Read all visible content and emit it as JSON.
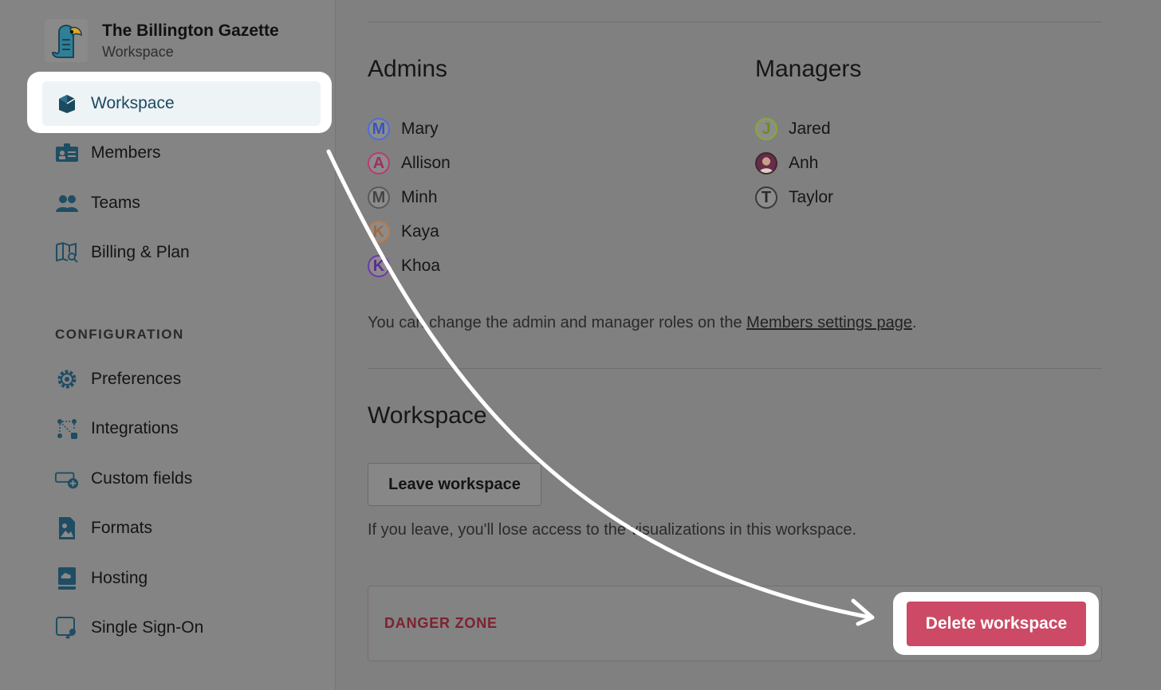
{
  "workspace": {
    "name": "The Billington Gazette",
    "subtitle": "Workspace"
  },
  "sidebar": {
    "items": [
      {
        "label": "Workspace",
        "icon": "cube-icon",
        "active": true
      },
      {
        "label": "Members",
        "icon": "id-card-icon"
      },
      {
        "label": "Teams",
        "icon": "people-icon"
      },
      {
        "label": "Billing & Plan",
        "icon": "map-icon"
      }
    ],
    "section_label": "CONFIGURATION",
    "config_items": [
      {
        "label": "Preferences",
        "icon": "gear-icon"
      },
      {
        "label": "Integrations",
        "icon": "nodes-icon"
      },
      {
        "label": "Custom fields",
        "icon": "field-add-icon"
      },
      {
        "label": "Formats",
        "icon": "image-file-icon"
      },
      {
        "label": "Hosting",
        "icon": "cloud-server-icon"
      },
      {
        "label": "Single Sign-On",
        "icon": "key-icon"
      }
    ]
  },
  "main": {
    "admins_title": "Admins",
    "managers_title": "Managers",
    "admins": [
      {
        "name": "Mary",
        "initial": "M",
        "color": "#4a6fd8"
      },
      {
        "name": "Allison",
        "initial": "A",
        "color": "#b83a75"
      },
      {
        "name": "Minh",
        "initial": "M",
        "color": "#5a5a5a"
      },
      {
        "name": "Kaya",
        "initial": "K",
        "color": "#b87a4a"
      },
      {
        "name": "Khoa",
        "initial": "K",
        "color": "#6b3aa8"
      }
    ],
    "managers": [
      {
        "name": "Jared",
        "initial": "J",
        "color": "#8aa832"
      },
      {
        "name": "Anh",
        "initial": "",
        "color": "#3a2a2a"
      },
      {
        "name": "Taylor",
        "initial": "T",
        "color": "#3a3a3a"
      }
    ],
    "roles_note_prefix": "You can change the admin and manager roles on the ",
    "roles_note_link": "Members settings page",
    "roles_note_suffix": ".",
    "workspace_title": "Workspace",
    "leave_button": "Leave workspace",
    "leave_note": "If you leave, you'll lose access to the visualizations in this workspace.",
    "danger_label": "DANGER ZONE",
    "delete_button": "Delete workspace"
  },
  "colors": {
    "accent": "#1b4a60",
    "danger": "#cc4a65"
  }
}
